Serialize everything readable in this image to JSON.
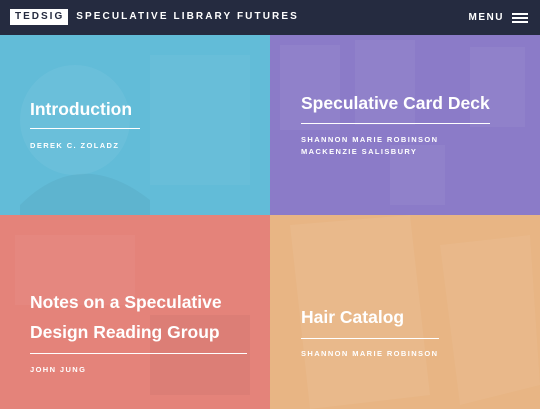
{
  "header": {
    "logo": "TEDSIG",
    "site_title": "SPECULATIVE LIBRARY FUTURES",
    "menu_label": "MENU"
  },
  "tiles": [
    {
      "title": "Introduction",
      "authors": [
        "DEREK C. ZOLADZ"
      ],
      "color": "#62bcd8"
    },
    {
      "title": "Speculative Card Deck",
      "authors": [
        "SHANNON MARIE ROBINSON",
        "MACKENZIE SALISBURY"
      ],
      "color": "#8b7bc8"
    },
    {
      "title_lines": [
        "Notes on a Speculative",
        "Design Reading Group"
      ],
      "authors": [
        "JOHN JUNG"
      ],
      "color": "#e4837a"
    },
    {
      "title": "Hair Catalog",
      "authors": [
        "SHANNON MARIE ROBINSON"
      ],
      "color": "#e8b584"
    }
  ],
  "colors": {
    "header_bg": "#252b40",
    "text": "#ffffff"
  },
  "icons": [
    "hamburger-menu-icon"
  ]
}
